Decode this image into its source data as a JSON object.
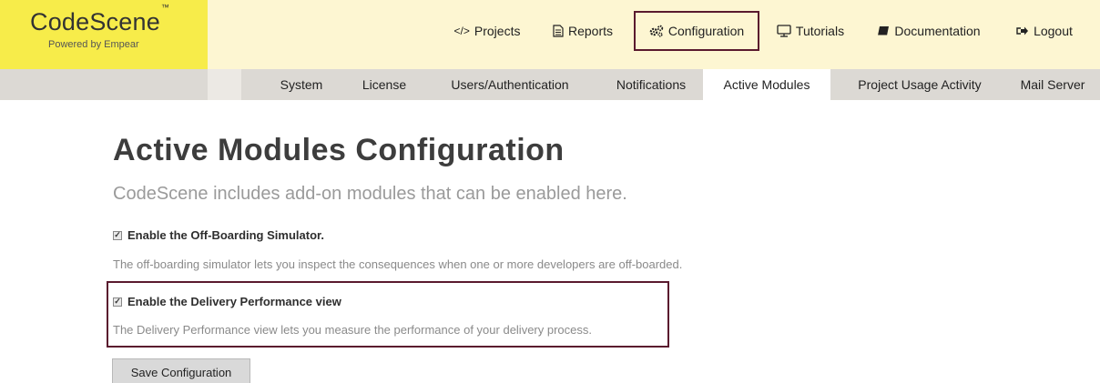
{
  "logo": {
    "title": "CodeScene",
    "trademark": "™",
    "subtitle": "Powered by Empear",
    "bg_color": "#f7ec4a"
  },
  "main_nav": {
    "items": [
      {
        "label": "Projects",
        "icon": "code-icon"
      },
      {
        "label": "Reports",
        "icon": "document-icon"
      },
      {
        "label": "Configuration",
        "icon": "gears-icon",
        "highlighted": true
      },
      {
        "label": "Tutorials",
        "icon": "monitor-icon"
      },
      {
        "label": "Documentation",
        "icon": "book-icon"
      },
      {
        "label": "Logout",
        "icon": "logout-icon"
      }
    ]
  },
  "sub_nav": {
    "items": [
      {
        "label": "System"
      },
      {
        "label": "License"
      },
      {
        "label": "Users/Authentication"
      },
      {
        "label": "Notifications"
      },
      {
        "label": "Active Modules",
        "active": true
      },
      {
        "label": "Project Usage Activity"
      },
      {
        "label": "Mail Server"
      }
    ]
  },
  "content": {
    "title": "Active Modules Configuration",
    "subtitle": "CodeScene includes add-on modules that can be enabled here.",
    "options": [
      {
        "label": "Enable the Off-Boarding Simulator.",
        "checked": true,
        "description": "The off-boarding simulator lets you inspect the consequences when one or more developers are off-boarded."
      },
      {
        "label": "Enable the Delivery Performance view",
        "checked": true,
        "highlighted": true,
        "description": "The Delivery Performance view lets you measure the performance of your delivery process."
      }
    ],
    "save_label": "Save Configuration"
  },
  "colors": {
    "highlight_border": "#5a1a2e",
    "header_bg": "#fdf6d2",
    "subnav_bg": "#dcd9d4"
  }
}
